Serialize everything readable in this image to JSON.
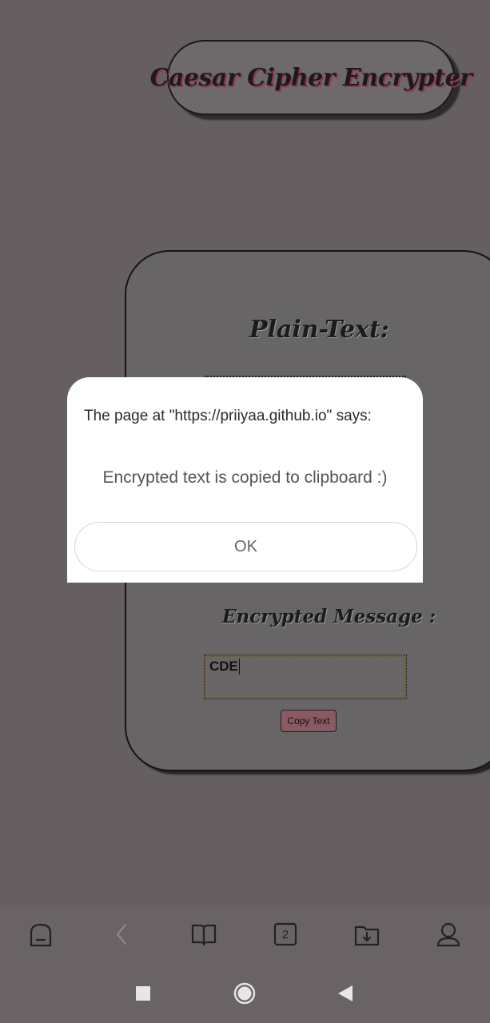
{
  "app": {
    "title": "Caesar Cipher Encrypter"
  },
  "card": {
    "plain_label": "Plain-Text:",
    "encrypted_label": "Encrypted Message :",
    "output_value": "CDE",
    "copy_button_label": "Copy Text"
  },
  "dialog": {
    "title": "The page at \"https://priiyaa.github.io\" says:",
    "message": "Encrypted text is copied to clipboard :)",
    "ok_label": "OK"
  },
  "browser_toolbar": {
    "tab_count": "2",
    "icons": [
      "home-icon",
      "back-icon",
      "bookmarks-icon",
      "tabs-icon",
      "downloads-icon",
      "profile-icon"
    ]
  },
  "system_nav": {
    "icons": [
      "recents-icon",
      "home-circle-icon",
      "back-triangle-icon"
    ]
  }
}
